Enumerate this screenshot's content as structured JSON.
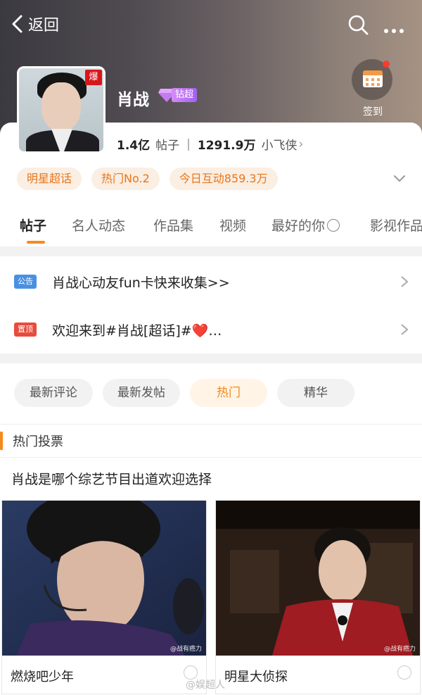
{
  "topbar": {
    "back_label": "返回",
    "back_icon": "chevron-left-icon",
    "search_icon": "search-icon",
    "more_icon": "more-dots-icon"
  },
  "profile": {
    "name": "肖战",
    "hot_badge": "爆",
    "level_badge": "钻超",
    "checkin_label": "签到",
    "posts_count": "1.4亿",
    "posts_unit": "帖子",
    "fans_count": "1291.9万",
    "fans_unit": "小飞侠"
  },
  "tags": [
    "明星超话",
    "热门No.2",
    "今日互动859.3万"
  ],
  "tabs": [
    "帖子",
    "名人动态",
    "作品集",
    "视频",
    "最好的你",
    "影视作品"
  ],
  "notices": [
    {
      "tag": "公告",
      "tag_color": "#4a90e2",
      "text": "肖战心动友fun卡快来收集>>"
    },
    {
      "tag": "置顶",
      "tag_color": "#e84c3d",
      "text": "欢迎来到#肖战[超话]#❤️…"
    }
  ],
  "filters": [
    "最新评论",
    "最新发帖",
    "热门",
    "精华"
  ],
  "poll": {
    "header": "热门投票",
    "question": "肖战是哪个综艺节目出道欢迎选择",
    "options": [
      "燃烧吧少年",
      "明星大侦探"
    ],
    "image_watermark": "@战有癌力"
  },
  "footer_watermark": "@娱超人",
  "colors": {
    "accent": "#f78a1b",
    "tag_bg": "#fbeee2",
    "tag_text": "#e8751a"
  }
}
